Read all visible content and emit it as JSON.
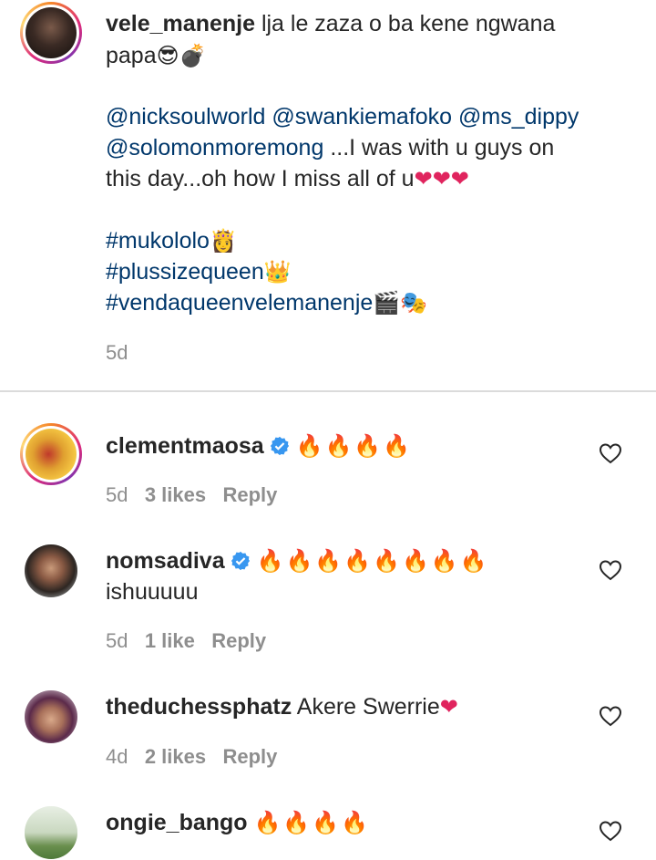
{
  "caption": {
    "username": "vele_manenje",
    "line1_text": " lja le zaza o ba kene ngwana",
    "line2_text": "papa",
    "line2_emoji": "😎💣",
    "mentions_line1": "@nicksoulworld @swankiemafoko @ms_dippy",
    "mention_line2": "@solomonmoremong",
    "line2_rest": " ...I was with u guys on",
    "line3_text": "this day...oh how I miss all of u",
    "line3_emoji": "❤❤❤",
    "hashtag1": "#mukololo",
    "hashtag1_emoji": "👸",
    "hashtag2": "#plussizequeen",
    "hashtag2_emoji": "👑",
    "hashtag3": "#vendaqueenvelemanenje",
    "hashtag3_emoji": "🎬🎭",
    "time": "5d"
  },
  "comments": [
    {
      "username": "clementmaosa",
      "verified": true,
      "text": "",
      "emoji": "🔥🔥🔥🔥",
      "time": "5d",
      "likes": "3 likes",
      "reply": "Reply"
    },
    {
      "username": "nomsadiva",
      "verified": true,
      "text": "ishuuuuu",
      "emoji": "🔥🔥🔥🔥🔥🔥🔥🔥",
      "time": "5d",
      "likes": "1 like",
      "reply": "Reply"
    },
    {
      "username": "theduchessphatz",
      "verified": false,
      "text": " Akere Swerrie",
      "emoji": "❤",
      "time": "4d",
      "likes": "2 likes",
      "reply": "Reply"
    },
    {
      "username": "ongie_bango",
      "verified": false,
      "text": "",
      "emoji": "🔥🔥🔥🔥",
      "time": "",
      "likes": "",
      "reply": ""
    }
  ],
  "colors": {
    "text": "#262626",
    "meta": "#8e8e8e",
    "link": "#00376b",
    "verified": "#3897f0",
    "divider": "#dbdbdb"
  },
  "icons": {
    "like": "heart-outline-icon",
    "verified": "verified-badge-icon"
  }
}
